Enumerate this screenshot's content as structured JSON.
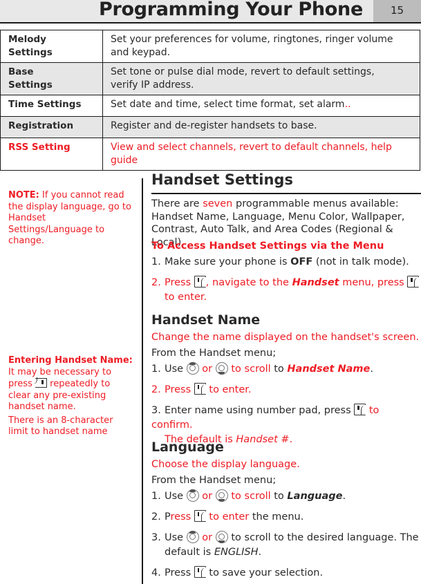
{
  "header": {
    "title": "Programming Your Phone",
    "page_number": "15"
  },
  "settings_table": [
    {
      "name": "Melody Settings",
      "name_l1": "Melody",
      "name_l2": "Settings",
      "description": "Set your preferences for volume, ringtones, ringer volume and keypad."
    },
    {
      "name": "Base Settings",
      "name_l1": "Base",
      "name_l2": "Settings",
      "description_l1": "Set tone or pulse dial mode, revert to default settings,",
      "description_l2": "verify IP address."
    },
    {
      "name": "Time Settings",
      "description": "Set date and time, select time format, set alarm",
      "description_suffix": ".."
    },
    {
      "name": "Registration",
      "description": "Register and de-register handsets to base."
    },
    {
      "name": "RSS Setting",
      "description": "View and select channels, revert to default channels, help guide"
    }
  ],
  "sidebar": {
    "note_label": "NOTE:",
    "note_text": " If you cannot read the display language, go to Handset Settings/Language to change.",
    "entering_label": "Entering Handset Name:",
    "entering_text_a": " It may be necessary to press ",
    "entering_text_b": " repeatedly to clear any pre-existing handset name.",
    "limit_text": "There is an 8-character limit to handset name"
  },
  "handset_settings": {
    "title": "Handset Settings",
    "intro_a": "There are ",
    "intro_highlight": "seven",
    "intro_b": " programmable menus available: Handset Name, Language, Menu Color, Wallpaper, Contrast, Auto Talk, and Area Codes (Regional & Local).",
    "access_heading": "To Access Handset Settings via the Menu",
    "step1": {
      "num": "1.",
      "a": "Make sure your phone is ",
      "bold": "OFF",
      "b": " (not in talk mode)."
    },
    "step2": {
      "num": "2.",
      "a": "Press ",
      "b": ", navigate to the ",
      "bold": "Handset",
      "c": " menu, press ",
      "d": "to enter."
    }
  },
  "handset_name": {
    "title": "Handset Name",
    "desc": "Change the name displayed on the handset's screen.",
    "from": "From the Handset menu;",
    "step1": {
      "num": "1.",
      "a": "Use ",
      "or": " or ",
      "b": " to scroll",
      "c": " to ",
      "target": "Handset Name",
      "end": "."
    },
    "step2": {
      "num": "2.",
      "a": "Press ",
      "b": " to enter."
    },
    "step3": {
      "num": "3.",
      "a": "Enter name using number pad, press ",
      "b": " to confirm.",
      "c": "The default is ",
      "default": "Handset #",
      "end": "."
    }
  },
  "language": {
    "title": "Language",
    "desc": "Choose the display language.",
    "from": "From the Handset menu;",
    "step1": {
      "num": "1.",
      "a": "Use ",
      "or": " or ",
      "b": " to scroll",
      "c": " to ",
      "target": "Language",
      "end": "."
    },
    "step2": {
      "num": "2.",
      "a": "P",
      "a_red": "ress ",
      "b": " to enter",
      "c": " the menu."
    },
    "step3": {
      "num": "3.",
      "a": "Use ",
      "or": " or ",
      "b": " to scroll to the desired language. The",
      "c": "default is ",
      "default": "ENGLISH",
      "end": "."
    },
    "step4": {
      "num": "4.",
      "a": "Press ",
      "b": " to save your selection."
    }
  },
  "icons": {
    "softkey": "menu-select-softkey-icon",
    "nav_up": "nav-up-key-icon",
    "nav_down": "nav-down-key-icon",
    "clear": "clear-key-icon"
  },
  "colors": {
    "accent_red": "#ee1c24",
    "header_bg": "#e8e8e8",
    "page_tab_bg": "#bcbcbc",
    "row_shade": "#e6e6e6"
  }
}
